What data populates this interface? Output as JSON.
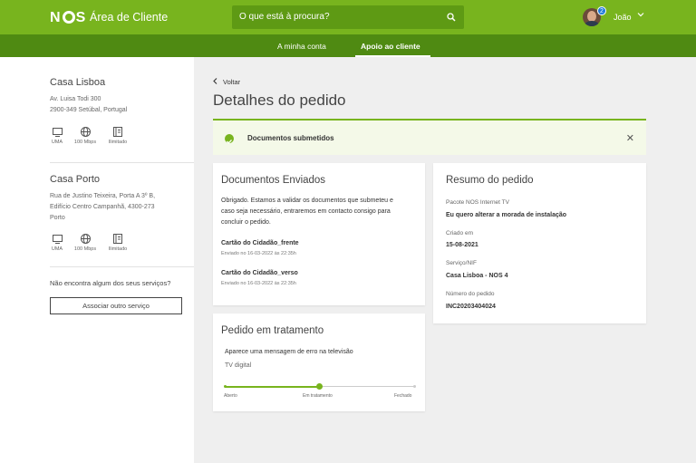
{
  "header": {
    "logo": "NOS",
    "title": "Área de Cliente",
    "search_placeholder": "O que está à procura?",
    "notification_count": "2",
    "user_name": "João"
  },
  "subnav": {
    "items": [
      {
        "label": "A minha conta",
        "active": false
      },
      {
        "label": "Apoio ao cliente",
        "active": true
      }
    ]
  },
  "sidebar": {
    "locations": [
      {
        "name": "Casa Lisboa",
        "address_lines": [
          "Av. Luisa Todi 300",
          "2900-349 Setúbal, Portugal"
        ],
        "services": [
          {
            "icon": "tv-icon",
            "label": "UMA"
          },
          {
            "icon": "globe-icon",
            "label": "100 Mbps"
          },
          {
            "icon": "phone-book-icon",
            "label": "Ilimitado"
          }
        ]
      },
      {
        "name": "Casa Porto",
        "address_lines": [
          "Rua de Justino Teixeira, Porta A 3º B,",
          "Edifício Centro Campanhã, 4300-273",
          "Porto"
        ],
        "services": [
          {
            "icon": "tv-icon",
            "label": "UMA"
          },
          {
            "icon": "globe-icon",
            "label": "100 Mbps"
          },
          {
            "icon": "phone-book-icon",
            "label": "Ilimitado"
          }
        ]
      }
    ],
    "missing_text": "Não encontra algum dos seus serviços?",
    "associate_button": "Associar outro serviço"
  },
  "main": {
    "back_label": "Voltar",
    "page_title": "Detalhes do pedido",
    "alert": {
      "text": "Documentos submetidos",
      "close": "✕"
    },
    "documents": {
      "title": "Documentos Enviados",
      "body_lines": [
        "Obrigado. Estamos a validar os documentos que submeteu e",
        "caso seja necessário, entraremos em contacto consigo para",
        "concluir o pedido."
      ],
      "items": [
        {
          "name": "Cartão do Cidadão_frente",
          "date": "Enviado no 16-03-2022 às 22:35h"
        },
        {
          "name": "Cartão do Cidadão_verso",
          "date": "Enviado no 16-03-2022 às 22:35h"
        }
      ]
    },
    "summary": {
      "title": "Resumo do pedido",
      "fields": [
        {
          "label": "Pacote NOS Internet TV",
          "value": "Eu quero alterar a morada de instalação"
        },
        {
          "label": "Criado em",
          "value": "15-08-2021"
        },
        {
          "label": "Serviço/NIF",
          "value": "Casa Lisboa - NOS 4"
        },
        {
          "label": "Número do pedido",
          "value": "INC20203404024"
        }
      ]
    },
    "status": {
      "title": "Pedido em tratamento",
      "description": "Aparece uma mensagem de erro na televisão",
      "category": "TV digital",
      "steps": [
        "Aberto",
        "Em tratamento",
        "Fechado"
      ],
      "current_step_index": 1,
      "progress_fraction": 0.5
    }
  },
  "colors": {
    "brand_green": "#78b41e",
    "dark_green": "#4f8a12",
    "search_green": "#5e9a14",
    "badge_blue": "#1f7ad9"
  }
}
